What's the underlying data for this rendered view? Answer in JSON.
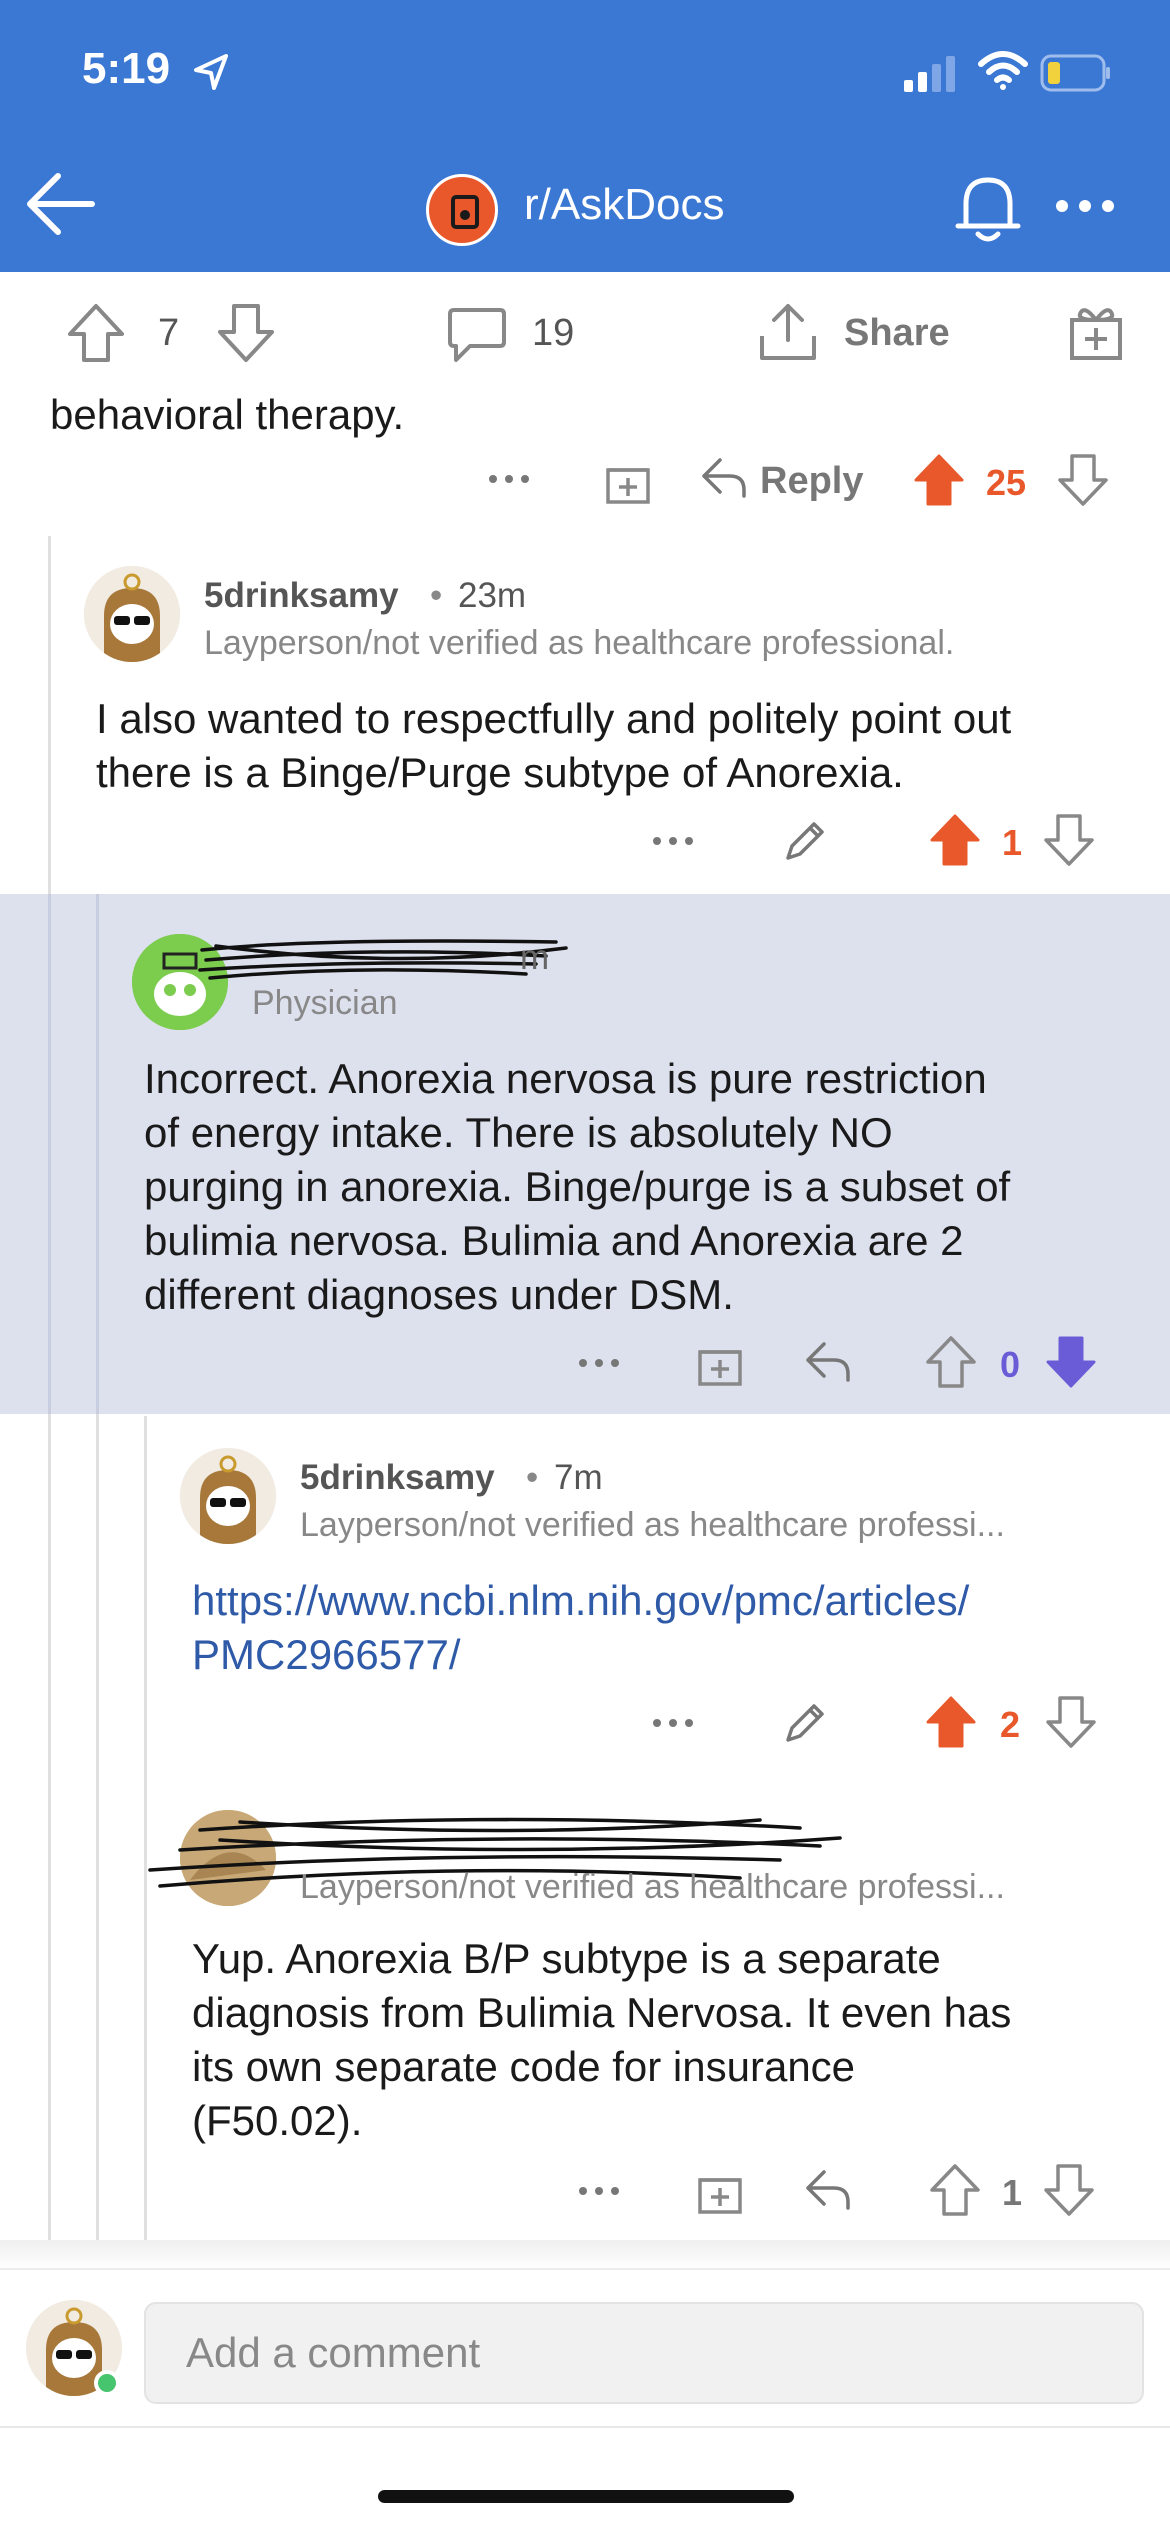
{
  "status_bar": {
    "time": "5:19"
  },
  "nav": {
    "subreddit": "r/AskDocs"
  },
  "post_actions": {
    "upvotes": "7",
    "comments": "19",
    "share_label": "Share"
  },
  "parent_tail": {
    "text": "behavioral therapy.",
    "reply_label": "Reply",
    "score": "25"
  },
  "comments": [
    {
      "author": "5drinksamy",
      "age": "23m",
      "flair": "Layperson/not verified as healthcare professional.",
      "lines": [
        "I also wanted to respectfully and politely point out",
        "there is a Binge/Purge subtype of Anorexia."
      ],
      "score": "1"
    },
    {
      "age_suffix": "m",
      "flair": "Physician",
      "lines": [
        "Incorrect. Anorexia nervosa is pure restriction",
        "of energy intake. There is absolutely NO",
        "purging in anorexia. Binge/purge is a subset of",
        "bulimia nervosa. Bulimia and Anorexia are 2",
        "different diagnoses under DSM."
      ],
      "score": "0"
    },
    {
      "author": "5drinksamy",
      "age": "7m",
      "flair": "Layperson/not verified as healthcare professi...",
      "link_lines": [
        "https://www.ncbi.nlm.nih.gov/pmc/articles/",
        "PMC2966577/"
      ],
      "score": "2"
    },
    {
      "flair": "Layperson/not verified as healthcare professi...",
      "lines": [
        "Yup. Anorexia B/P subtype is a separate",
        "diagnosis from Bulimia Nervosa. It even has",
        "its own separate code for insurance",
        "(F50.02)."
      ],
      "score": "1"
    }
  ],
  "composer": {
    "placeholder": "Add a comment"
  },
  "colors": {
    "header": "#3b78d4",
    "upvote": "#e8582a",
    "downvote": "#6a5cd6",
    "highlight": "#dde1ee",
    "link": "#2f5aa8"
  }
}
